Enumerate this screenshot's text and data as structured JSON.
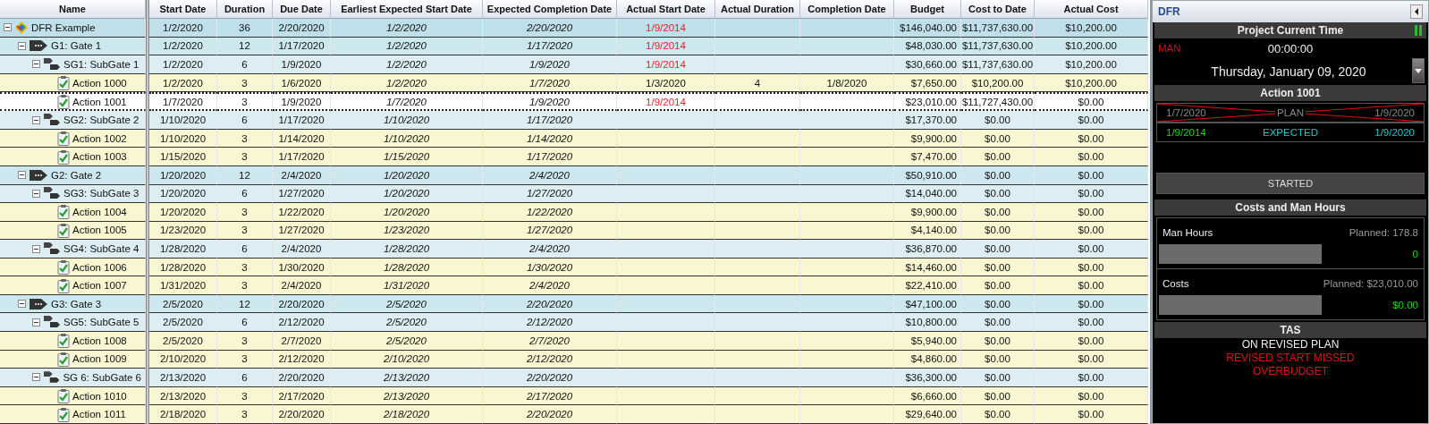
{
  "table": {
    "columns": [
      "Name",
      "Start Date",
      "Duration",
      "Due Date",
      "Earliest Expected Start Date",
      "Expected Completion Date",
      "Actual Start Date",
      "Actual Duration",
      "Completion Date",
      "Budget",
      "Cost to Date",
      "Actual Cost"
    ],
    "tree": [
      {
        "kind": "project",
        "name": "DFR Example",
        "expanded": true,
        "selected": false,
        "start": "1/2/2020",
        "duration": "36",
        "due": "2/20/2020",
        "earliest_start": "1/2/2020",
        "expected_completion": "2/20/2020",
        "actual_start": "1/9/2014",
        "actual_start_missed": true,
        "budget": "$146,040.00",
        "cost_to_date": "$11,737,630.00",
        "actual_cost": "$10,200.00",
        "children": [
          {
            "kind": "gate",
            "name": "G1: Gate 1",
            "expanded": true,
            "selected": false,
            "start": "1/2/2020",
            "duration": "12",
            "due": "1/17/2020",
            "earliest_start": "1/2/2020",
            "expected_completion": "1/17/2020",
            "actual_start": "1/9/2014",
            "actual_start_missed": true,
            "budget": "$48,030.00",
            "cost_to_date": "$11,737,630.00",
            "actual_cost": "$10,200.00",
            "children": [
              {
                "kind": "subgate",
                "name": "SG1: SubGate 1",
                "expanded": true,
                "selected": false,
                "start": "1/2/2020",
                "duration": "6",
                "due": "1/9/2020",
                "earliest_start": "1/2/2020",
                "expected_completion": "1/9/2020",
                "actual_start": "1/9/2014",
                "actual_start_missed": true,
                "budget": "$30,660.00",
                "cost_to_date": "$11,737,630.00",
                "actual_cost": "$10,200.00",
                "children": [
                  {
                    "kind": "action",
                    "name": "Action 1000",
                    "selected": false,
                    "start": "1/2/2020",
                    "duration": "3",
                    "due": "1/6/2020",
                    "earliest_start": "1/2/2020",
                    "expected_completion": "1/7/2020",
                    "actual_start": "1/3/2020",
                    "actual_start_missed": false,
                    "actual_duration": "4",
                    "completion": "1/8/2020",
                    "budget": "$7,650.00",
                    "cost_to_date": "$10,200.00",
                    "actual_cost": "$10,200.00"
                  },
                  {
                    "kind": "action",
                    "name": "Action 1001",
                    "selected": true,
                    "start": "1/7/2020",
                    "duration": "3",
                    "due": "1/9/2020",
                    "earliest_start": "1/7/2020",
                    "expected_completion": "1/9/2020",
                    "actual_start": "1/9/2014",
                    "actual_start_missed": true,
                    "budget": "$23,010.00",
                    "cost_to_date": "$11,727,430.00",
                    "actual_cost": "$0.00"
                  }
                ]
              },
              {
                "kind": "subgate",
                "name": "SG2: SubGate 2",
                "expanded": true,
                "selected": false,
                "start": "1/10/2020",
                "duration": "6",
                "due": "1/17/2020",
                "earliest_start": "1/10/2020",
                "expected_completion": "1/17/2020",
                "budget": "$17,370.00",
                "cost_to_date": "$0.00",
                "actual_cost": "$0.00",
                "children": [
                  {
                    "kind": "action",
                    "name": "Action 1002",
                    "selected": false,
                    "start": "1/10/2020",
                    "duration": "3",
                    "due": "1/14/2020",
                    "earliest_start": "1/10/2020",
                    "expected_completion": "1/14/2020",
                    "budget": "$9,900.00",
                    "cost_to_date": "$0.00",
                    "actual_cost": "$0.00"
                  },
                  {
                    "kind": "action",
                    "name": "Action 1003",
                    "selected": false,
                    "start": "1/15/2020",
                    "duration": "3",
                    "due": "1/17/2020",
                    "earliest_start": "1/15/2020",
                    "expected_completion": "1/17/2020",
                    "budget": "$7,470.00",
                    "cost_to_date": "$0.00",
                    "actual_cost": "$0.00"
                  }
                ]
              }
            ]
          },
          {
            "kind": "gate",
            "name": "G2: Gate 2",
            "expanded": true,
            "selected": false,
            "start": "1/20/2020",
            "duration": "12",
            "due": "2/4/2020",
            "earliest_start": "1/20/2020",
            "expected_completion": "2/4/2020",
            "budget": "$50,910.00",
            "cost_to_date": "$0.00",
            "actual_cost": "$0.00",
            "children": [
              {
                "kind": "subgate",
                "name": "SG3: SubGate 3",
                "expanded": true,
                "selected": false,
                "start": "1/20/2020",
                "duration": "6",
                "due": "1/27/2020",
                "earliest_start": "1/20/2020",
                "expected_completion": "1/27/2020",
                "budget": "$14,040.00",
                "cost_to_date": "$0.00",
                "actual_cost": "$0.00",
                "children": [
                  {
                    "kind": "action",
                    "name": "Action 1004",
                    "selected": false,
                    "start": "1/20/2020",
                    "duration": "3",
                    "due": "1/22/2020",
                    "earliest_start": "1/20/2020",
                    "expected_completion": "1/22/2020",
                    "budget": "$9,900.00",
                    "cost_to_date": "$0.00",
                    "actual_cost": "$0.00"
                  },
                  {
                    "kind": "action",
                    "name": "Action 1005",
                    "selected": false,
                    "start": "1/23/2020",
                    "duration": "3",
                    "due": "1/27/2020",
                    "earliest_start": "1/23/2020",
                    "expected_completion": "1/27/2020",
                    "budget": "$4,140.00",
                    "cost_to_date": "$0.00",
                    "actual_cost": "$0.00"
                  }
                ]
              },
              {
                "kind": "subgate",
                "name": "SG4: SubGate 4",
                "expanded": true,
                "selected": false,
                "start": "1/28/2020",
                "duration": "6",
                "due": "2/4/2020",
                "earliest_start": "1/28/2020",
                "expected_completion": "2/4/2020",
                "budget": "$36,870.00",
                "cost_to_date": "$0.00",
                "actual_cost": "$0.00",
                "children": [
                  {
                    "kind": "action",
                    "name": "Action 1006",
                    "selected": false,
                    "start": "1/28/2020",
                    "duration": "3",
                    "due": "1/30/2020",
                    "earliest_start": "1/28/2020",
                    "expected_completion": "1/30/2020",
                    "budget": "$14,460.00",
                    "cost_to_date": "$0.00",
                    "actual_cost": "$0.00"
                  },
                  {
                    "kind": "action",
                    "name": "Action 1007",
                    "selected": false,
                    "start": "1/31/2020",
                    "duration": "3",
                    "due": "2/4/2020",
                    "earliest_start": "1/31/2020",
                    "expected_completion": "2/4/2020",
                    "budget": "$22,410.00",
                    "cost_to_date": "$0.00",
                    "actual_cost": "$0.00"
                  }
                ]
              }
            ]
          },
          {
            "kind": "gate",
            "name": "G3: Gate 3",
            "expanded": true,
            "selected": false,
            "start": "2/5/2020",
            "duration": "12",
            "due": "2/20/2020",
            "earliest_start": "2/5/2020",
            "expected_completion": "2/20/2020",
            "budget": "$47,100.00",
            "cost_to_date": "$0.00",
            "actual_cost": "$0.00",
            "children": [
              {
                "kind": "subgate",
                "name": "SG5: SubGate 5",
                "expanded": true,
                "selected": false,
                "start": "2/5/2020",
                "duration": "6",
                "due": "2/12/2020",
                "earliest_start": "2/5/2020",
                "expected_completion": "2/12/2020",
                "budget": "$10,800.00",
                "cost_to_date": "$0.00",
                "actual_cost": "$0.00",
                "children": [
                  {
                    "kind": "action",
                    "name": "Action 1008",
                    "selected": false,
                    "start": "2/5/2020",
                    "duration": "3",
                    "due": "2/7/2020",
                    "earliest_start": "2/5/2020",
                    "expected_completion": "2/7/2020",
                    "budget": "$5,940.00",
                    "cost_to_date": "$0.00",
                    "actual_cost": "$0.00"
                  },
                  {
                    "kind": "action",
                    "name": "Action 1009",
                    "selected": false,
                    "start": "2/10/2020",
                    "duration": "3",
                    "due": "2/12/2020",
                    "earliest_start": "2/10/2020",
                    "expected_completion": "2/12/2020",
                    "budget": "$4,860.00",
                    "cost_to_date": "$0.00",
                    "actual_cost": "$0.00"
                  }
                ]
              },
              {
                "kind": "subgate",
                "name": "SG 6: SubGate 6",
                "expanded": true,
                "selected": false,
                "start": "2/13/2020",
                "duration": "6",
                "due": "2/20/2020",
                "earliest_start": "2/13/2020",
                "expected_completion": "2/20/2020",
                "budget": "$36,300.00",
                "cost_to_date": "$0.00",
                "actual_cost": "$0.00",
                "children": [
                  {
                    "kind": "action",
                    "name": "Action 1010",
                    "selected": false,
                    "start": "2/13/2020",
                    "duration": "3",
                    "due": "2/17/2020",
                    "earliest_start": "2/13/2020",
                    "expected_completion": "2/17/2020",
                    "budget": "$6,660.00",
                    "cost_to_date": "$0.00",
                    "actual_cost": "$0.00"
                  },
                  {
                    "kind": "action",
                    "name": "Action 1011",
                    "selected": false,
                    "start": "2/18/2020",
                    "duration": "3",
                    "due": "2/20/2020",
                    "earliest_start": "2/18/2020",
                    "expected_completion": "2/20/2020",
                    "budget": "$29,640.00",
                    "cost_to_date": "$0.00",
                    "actual_cost": "$0.00"
                  }
                ]
              }
            ]
          }
        ]
      }
    ]
  },
  "panel": {
    "title": "DFR",
    "clock": {
      "heading": "Project Current Time",
      "mode": "MAN",
      "time": "00:00:00",
      "date": "Thursday, January 09, 2020"
    },
    "item": {
      "heading": "Action 1001",
      "lines": [
        {
          "start": "1/7/2020",
          "label": "PLAN",
          "end": "1/9/2020",
          "crossed": true
        },
        {
          "start": "1/9/2014",
          "label": "EXPECTED",
          "end": "1/9/2020",
          "crossed": false
        }
      ],
      "status_button": "STARTED"
    },
    "costs": {
      "heading": "Costs and Man Hours",
      "meters": [
        {
          "label": "Man Hours",
          "planned": "Planned: 178.8",
          "level": 0,
          "value": "0"
        },
        {
          "label": "Costs",
          "planned": "Planned: $23,010.00",
          "level": 0,
          "value": "$0.00"
        }
      ]
    },
    "tas": {
      "heading": "TAS",
      "messages": [
        {
          "text": "ON REVISED PLAN",
          "alert": false
        },
        {
          "text": "REVISED START MISSED",
          "alert": true
        },
        {
          "text": "OVERBUDGET",
          "alert": true
        }
      ]
    }
  }
}
